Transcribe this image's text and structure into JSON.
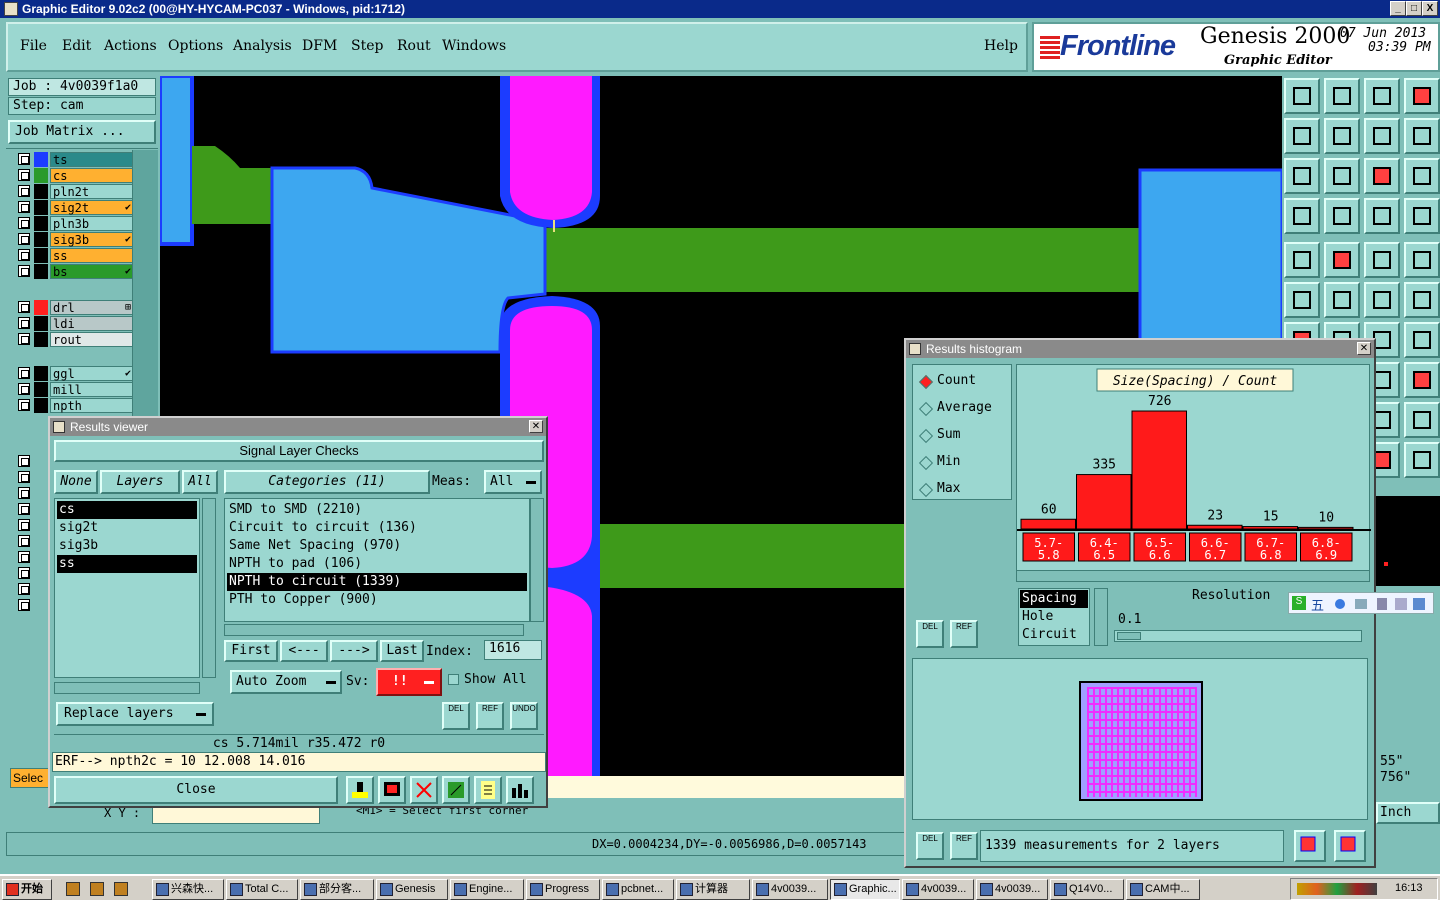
{
  "window": {
    "title": "Graphic Editor 9.02c2 (00@HY-HYCAM-PC037 - Windows, pid:1712)",
    "min": "_",
    "max": "□",
    "close": "X"
  },
  "menu": {
    "items": [
      "File",
      "Edit",
      "Actions",
      "Options",
      "Analysis",
      "DFM",
      "Step",
      "Rout",
      "Windows"
    ],
    "help": "Help"
  },
  "logo": {
    "brand": "Frontline",
    "product": "Genesis 2000",
    "subtitle": "Graphic Editor",
    "date": "07 Jun 2013",
    "time": "03:39 PM"
  },
  "job": {
    "job_label": "Job : 4v0039f1a0",
    "step_label": "Step: cam",
    "matrix_button": "Job Matrix ..."
  },
  "layers": [
    {
      "name": "ts",
      "color": "#2a8a8a",
      "swatch": "#1c3cff",
      "mark": ""
    },
    {
      "name": "cs",
      "color": "#ffb030",
      "swatch": "#2a9a2a",
      "mark": ""
    },
    {
      "name": "pln2t",
      "color": "#9bd7d0",
      "swatch": "#000000",
      "mark": ""
    },
    {
      "name": "sig2t",
      "color": "#ffb030",
      "swatch": "#000000",
      "mark": "✔"
    },
    {
      "name": "pln3b",
      "color": "#9bd7d0",
      "swatch": "#000000",
      "mark": ""
    },
    {
      "name": "sig3b",
      "color": "#ffb030",
      "swatch": "#000000",
      "mark": "✔"
    },
    {
      "name": "ss",
      "color": "#ffb030",
      "swatch": "#000000",
      "mark": ""
    },
    {
      "name": "bs",
      "color": "#2a9a2a",
      "swatch": "#000000",
      "mark": "✔"
    },
    {
      "name": "drl",
      "color": "#b8c8c8",
      "swatch": "#ff2020",
      "mark": "⊞"
    },
    {
      "name": "ldi",
      "color": "#b8c8c8",
      "swatch": "#000000",
      "mark": ""
    },
    {
      "name": "rout",
      "color": "#e0e8e8",
      "swatch": "#000000",
      "mark": ""
    },
    {
      "name": "ggl",
      "color": "#9bd7d0",
      "swatch": "#000000",
      "mark": "✔"
    },
    {
      "name": "mill",
      "color": "#9bd7d0",
      "swatch": "#000000",
      "mark": ""
    },
    {
      "name": "npth",
      "color": "#9bd7d0",
      "swatch": "#000000",
      "mark": ""
    }
  ],
  "results_viewer": {
    "title": "Results viewer",
    "header": "Signal Layer Checks",
    "none": "None",
    "layers": "Layers",
    "all": "All",
    "categories_btn": "Categories (11)",
    "meas_label": "Meas:",
    "meas_value": "All",
    "layer_list": [
      {
        "name": "cs",
        "sel": true
      },
      {
        "name": "sig2t",
        "sel": false
      },
      {
        "name": "sig3b",
        "sel": false
      },
      {
        "name": "ss",
        "sel": true
      }
    ],
    "categories": [
      {
        "label": "SMD to SMD (2210)",
        "sel": false
      },
      {
        "label": "Circuit to circuit (136)",
        "sel": false
      },
      {
        "label": "Same Net Spacing (970)",
        "sel": false
      },
      {
        "label": "NPTH to pad (106)",
        "sel": false
      },
      {
        "label": "NPTH to circuit (1339)",
        "sel": true
      },
      {
        "label": "PTH to Copper (900)",
        "sel": false
      }
    ],
    "first": "First",
    "prev": "<---",
    "next": "--->",
    "last": "Last",
    "index_label": "Index:",
    "index_value": "1616",
    "auto_zoom": "Auto Zoom",
    "sv_label": "Sv:",
    "sv_value": "!!",
    "show_all": "Show All",
    "replace_layers": "Replace layers",
    "del": "DEL",
    "ref": "REF",
    "undo": "UNDO",
    "status": "cs 5.714mil  r35.472  r0",
    "erf": "ERF--> npth2c = 10 12.008 14.016",
    "close": "Close"
  },
  "histogram": {
    "title": "Results histogram",
    "modes": [
      {
        "label": "Count",
        "sel": true
      },
      {
        "label": "Average",
        "sel": false
      },
      {
        "label": "Sum",
        "sel": false
      },
      {
        "label": "Min",
        "sel": false
      },
      {
        "label": "Max",
        "sel": false
      }
    ],
    "chart_title": "Size(Spacing) / Count",
    "resolution_label": "Resolution",
    "resolution_value": "0.1",
    "types": [
      {
        "label": "Spacing",
        "sel": true
      },
      {
        "label": "Hole",
        "sel": false
      },
      {
        "label": "Circuit",
        "sel": false
      }
    ],
    "summary": "1339 measurements for 2 layers",
    "del": "DEL",
    "ref": "REF"
  },
  "chart_data": {
    "type": "bar",
    "title": "Size(Spacing) / Count",
    "categories": [
      "5.7-5.8",
      "6.4-6.5",
      "6.5-6.6",
      "6.6-6.7",
      "6.7-6.8",
      "6.8-6.9"
    ],
    "values": [
      60,
      335,
      726,
      23,
      15,
      10
    ],
    "ylim": [
      0,
      800
    ],
    "bar_color": "#ff1a1a"
  },
  "statusbar": {
    "coords": "DX=0.0004234,DY=-0.0056986,D=0.0057143",
    "prompt": "<M1> = Select first corner",
    "select": "Selec",
    "xy_label": "X Y :",
    "unit": "Inch",
    "right_vals": [
      "55\"",
      "756\""
    ]
  },
  "ime": {
    "label": "五"
  },
  "taskbar": {
    "start": "开始",
    "items": [
      "兴森快...",
      "Total C...",
      "部分客...",
      "Genesis",
      "Engine...",
      "Progress",
      "pcbnet...",
      "计算器",
      "4v0039...",
      "Graphic...",
      "4v0039...",
      "4v0039...",
      "Q14V0...",
      "CAM中..."
    ],
    "clock": "16:13"
  }
}
